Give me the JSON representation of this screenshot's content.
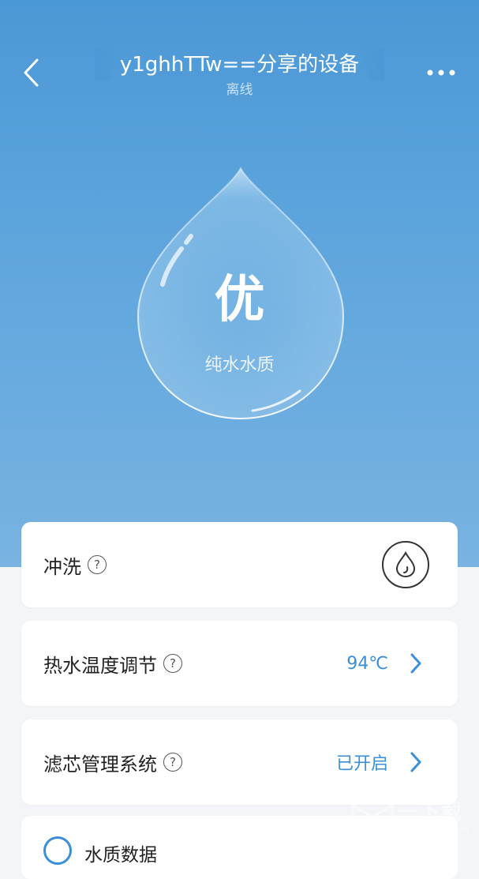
{
  "header": {
    "title": "y1ghhTTw==分享的设备",
    "status": "离线",
    "back_icon": "chevron-left-icon",
    "more_icon": "more-dots-icon"
  },
  "hero": {
    "grade": "优",
    "grade_label": "纯水水质",
    "drop_icon": "water-drop-icon"
  },
  "cards": [
    {
      "label": "冲洗",
      "help": "?",
      "action_icon": "water-drop-circle-icon"
    },
    {
      "label": "热水温度调节",
      "help": "?",
      "value": "94℃",
      "chevron_icon": "chevron-right-icon"
    },
    {
      "label": "滤芯管理系统",
      "help": "?",
      "value": "已开启",
      "chevron_icon": "chevron-right-icon"
    }
  ],
  "partial_card": {
    "label": "水质数据"
  },
  "watermark": {
    "text": "一下载",
    "url": "www.yxi4.com"
  },
  "colors": {
    "hero_top": "#4b98d6",
    "hero_bottom": "#78b3e2",
    "accent": "#3a8fd8",
    "page_bg": "#f3f5f8"
  }
}
